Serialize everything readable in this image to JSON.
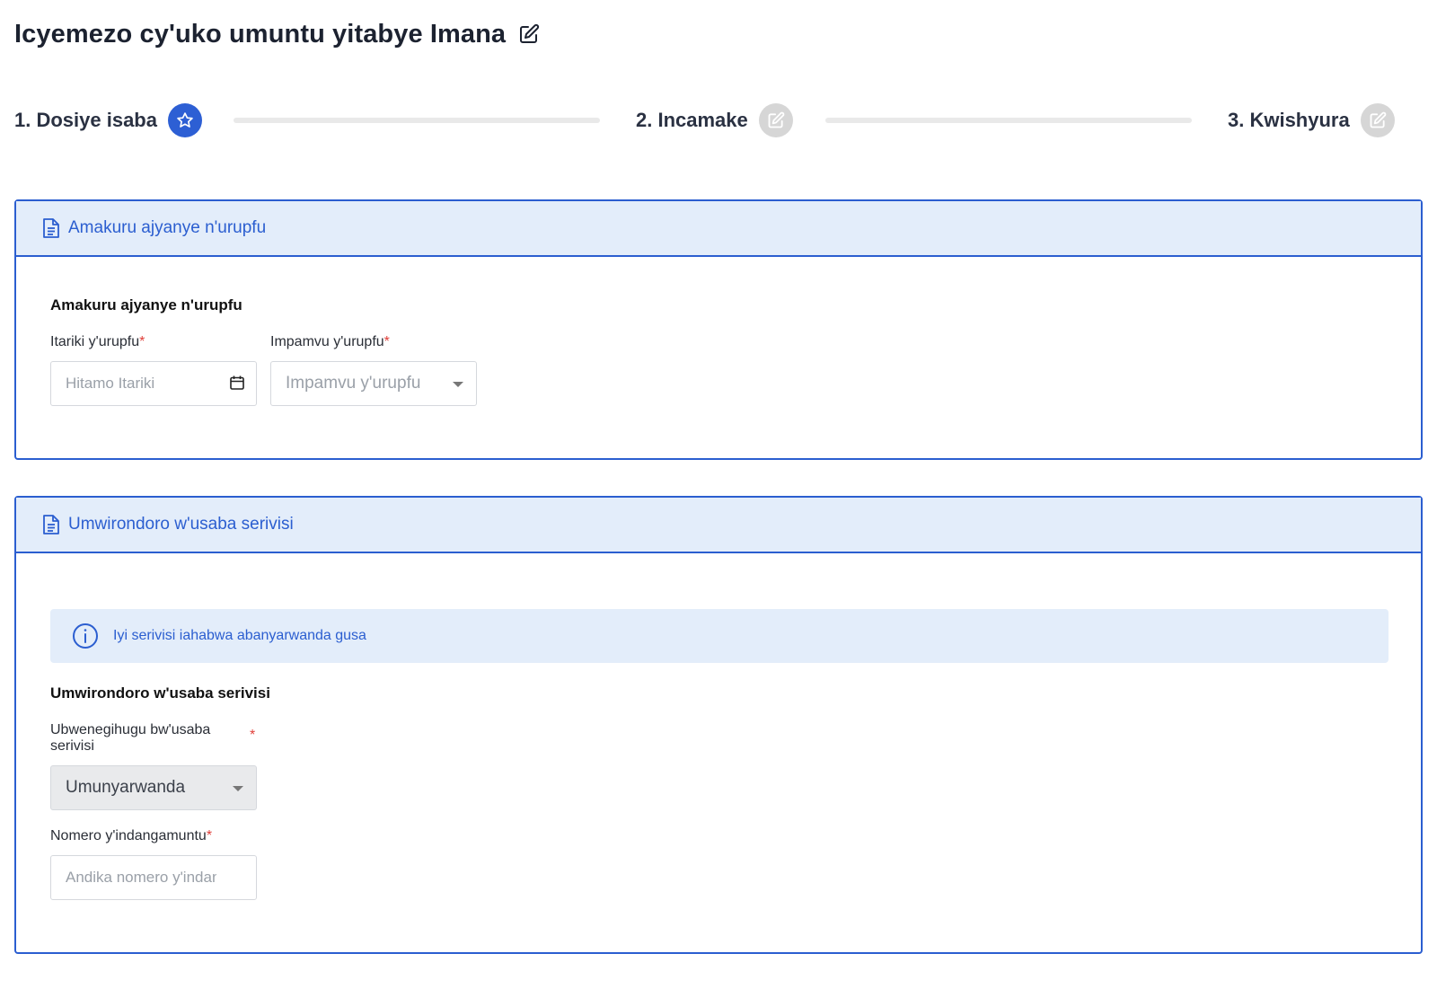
{
  "page": {
    "title": "Icyemezo cy'uko umuntu yitabye Imana"
  },
  "stepper": {
    "steps": [
      {
        "label": "1. Dosiye isaba",
        "state": "active",
        "icon": "star-icon"
      },
      {
        "label": "2. Incamake",
        "state": "inactive",
        "icon": "edit-icon"
      },
      {
        "label": "3. Kwishyura",
        "state": "inactive",
        "icon": "edit-icon"
      }
    ]
  },
  "death_info": {
    "header_title": "Amakuru ajyanye n'urupfu",
    "section_title": "Amakuru ajyanye n'urupfu",
    "date_label": "Itariki y'urupfu",
    "date_placeholder": "Hitamo Itariki",
    "cause_label": "Impamvu y'urupfu",
    "cause_placeholder": "Impamvu y'urupfu"
  },
  "requester": {
    "header_title": "Umwirondoro w'usaba serivisi",
    "alert_text": "Iyi serivisi iahabwa abanyarwanda gusa",
    "section_title": "Umwirondoro w'usaba serivisi",
    "nationality_label": "Ubwenegihugu bw'usaba serivisi",
    "nationality_value": "Umunyarwanda",
    "id_label": "Nomero y'indangamuntu",
    "id_placeholder": "Andika nomero y'indangamuntu"
  },
  "required_mark": "*",
  "colors": {
    "primary": "#2b5ed0",
    "header_bg": "#e3edfa",
    "required": "#e0403a",
    "inactive_badge": "#d6d6d6"
  }
}
